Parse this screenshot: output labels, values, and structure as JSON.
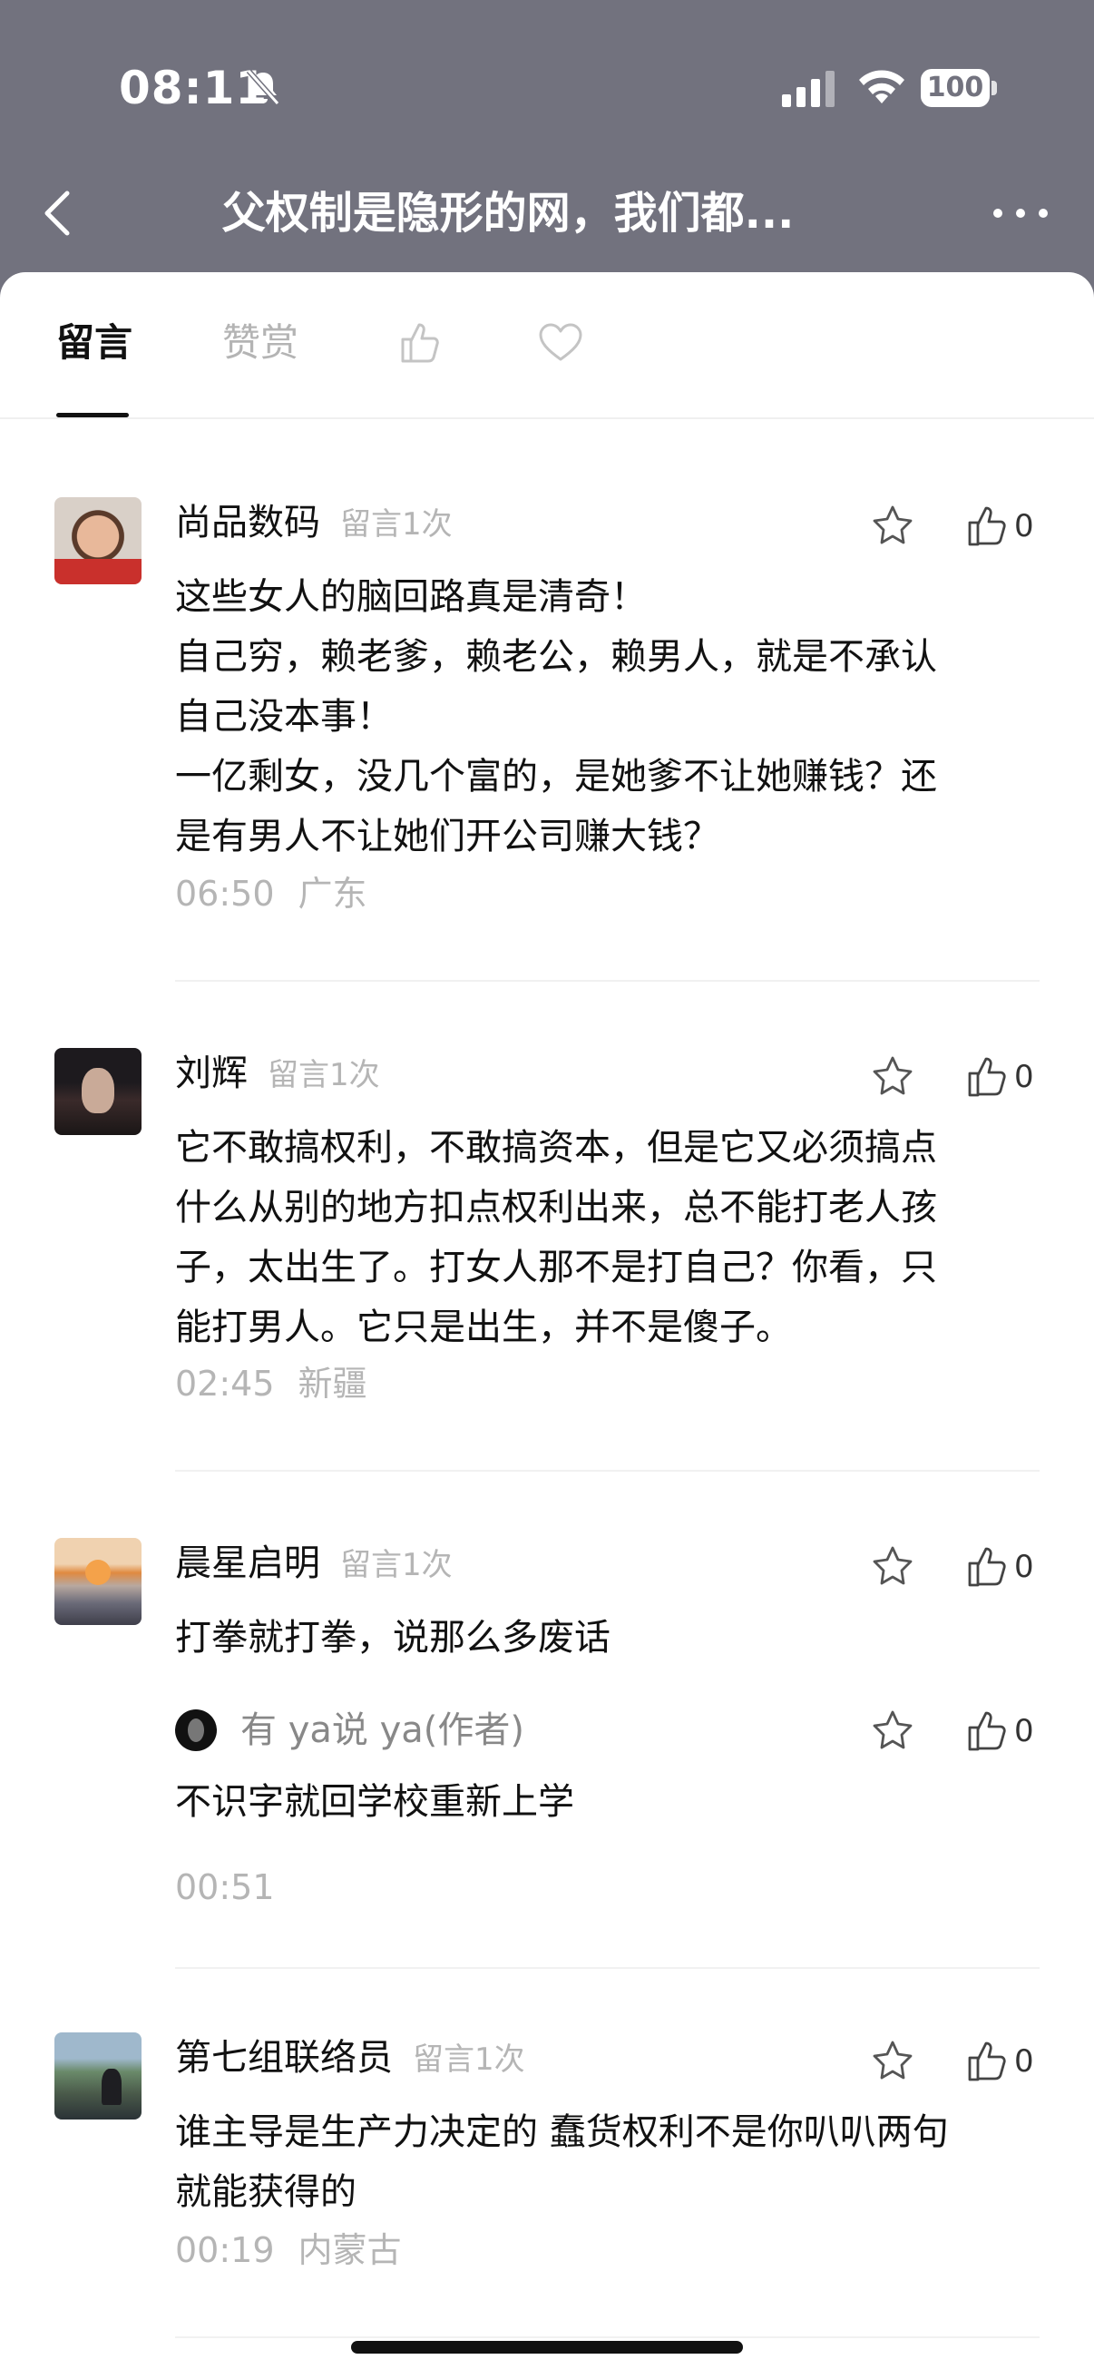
{
  "status_bar": {
    "time": "08:11",
    "battery": "100"
  },
  "nav": {
    "title": "父权制是隐形的网，我们都..."
  },
  "tabs": {
    "comments_label": "留言",
    "reward_label": "赞赏"
  },
  "comments": [
    {
      "name": "尚品数码",
      "count": "留言1次",
      "likes": "0",
      "lines": [
        "这些女人的脑回路真是清奇！",
        "自己穷，赖老爹，赖老公，赖男人，就是不承认",
        "自己没本事！",
        "一亿剩女，没几个富的，是她爹不让她赚钱？还",
        "是有男人不让她们开公司赚大钱？"
      ],
      "time": "06:50",
      "location": "广东"
    },
    {
      "name": "刘辉",
      "count": "留言1次",
      "likes": "0",
      "lines": [
        "它不敢搞权利，不敢搞资本，但是它又必须搞点",
        "什么从别的地方扣点权利出来，总不能打老人孩",
        "子，太出生了。打女人那不是打自己？你看，只",
        "能打男人。它只是出生，并不是傻子。"
      ],
      "time": "02:45",
      "location": "新疆"
    },
    {
      "name": "晨星启明",
      "count": "留言1次",
      "likes": "0",
      "lines": [
        "打拳就打拳，说那么多废话"
      ],
      "reply": {
        "name": "有 ya说 ya(作者)",
        "likes": "0",
        "text": "不识字就回学校重新上学"
      },
      "time": "00:51"
    },
    {
      "name": "第七组联络员",
      "count": "留言1次",
      "likes": "0",
      "lines": [
        "谁主导是生产力决定的 蠢货权利不是你叭叭两句",
        "就能获得的"
      ],
      "time": "00:19",
      "location": "内蒙古"
    }
  ]
}
